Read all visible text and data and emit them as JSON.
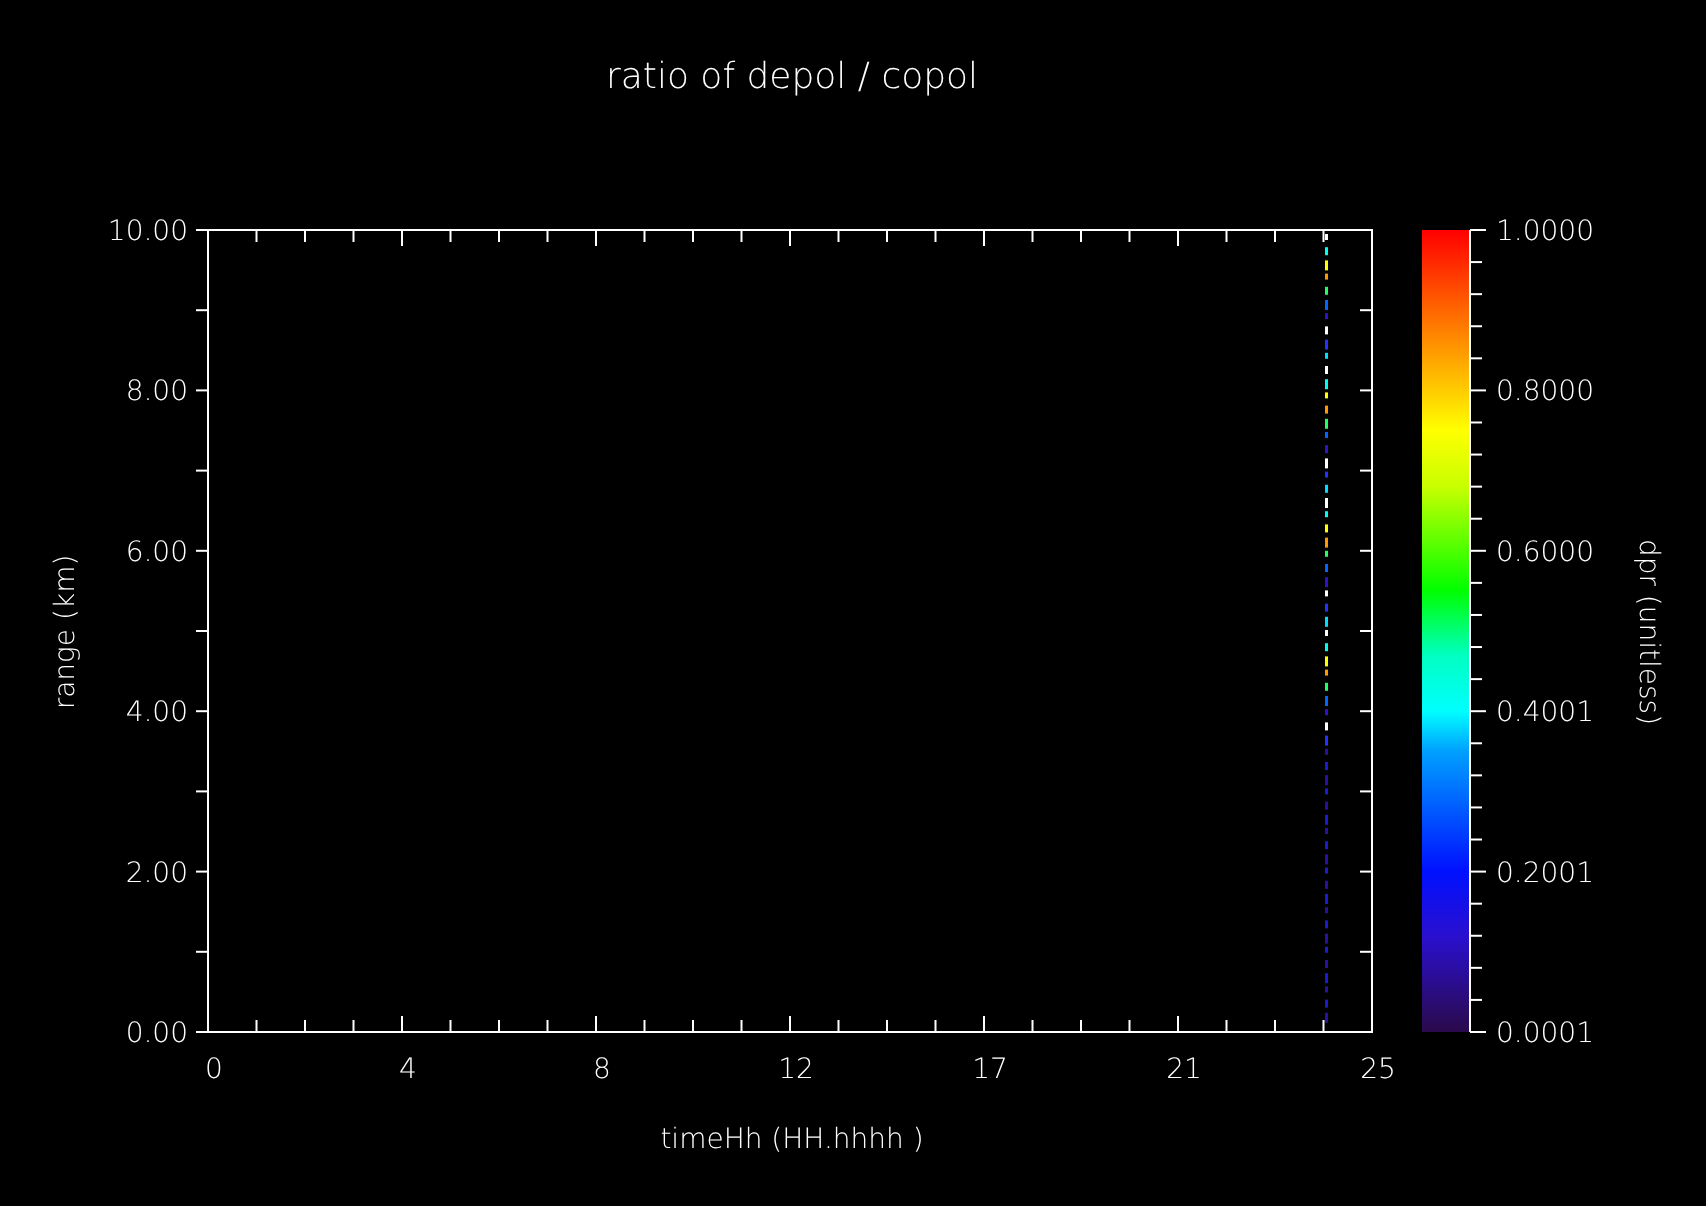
{
  "plot": {
    "title": "ratio of depol / copol",
    "xlabel": "timeHh (HH.hhhh )",
    "ylabel": "range (km)",
    "xtick_labels": [
      "0",
      "4",
      "8",
      "12",
      "17",
      "21",
      "25"
    ],
    "ytick_labels": [
      "10.00",
      "8.00",
      "6.00",
      "4.00",
      "2.00",
      "0.00"
    ],
    "colorbar": {
      "label": "dpr (unitless)",
      "tick_labels": [
        "1.0000",
        "0.8000",
        "0.6000",
        "0.4001",
        "0.2001",
        "0.0001"
      ]
    }
  }
}
